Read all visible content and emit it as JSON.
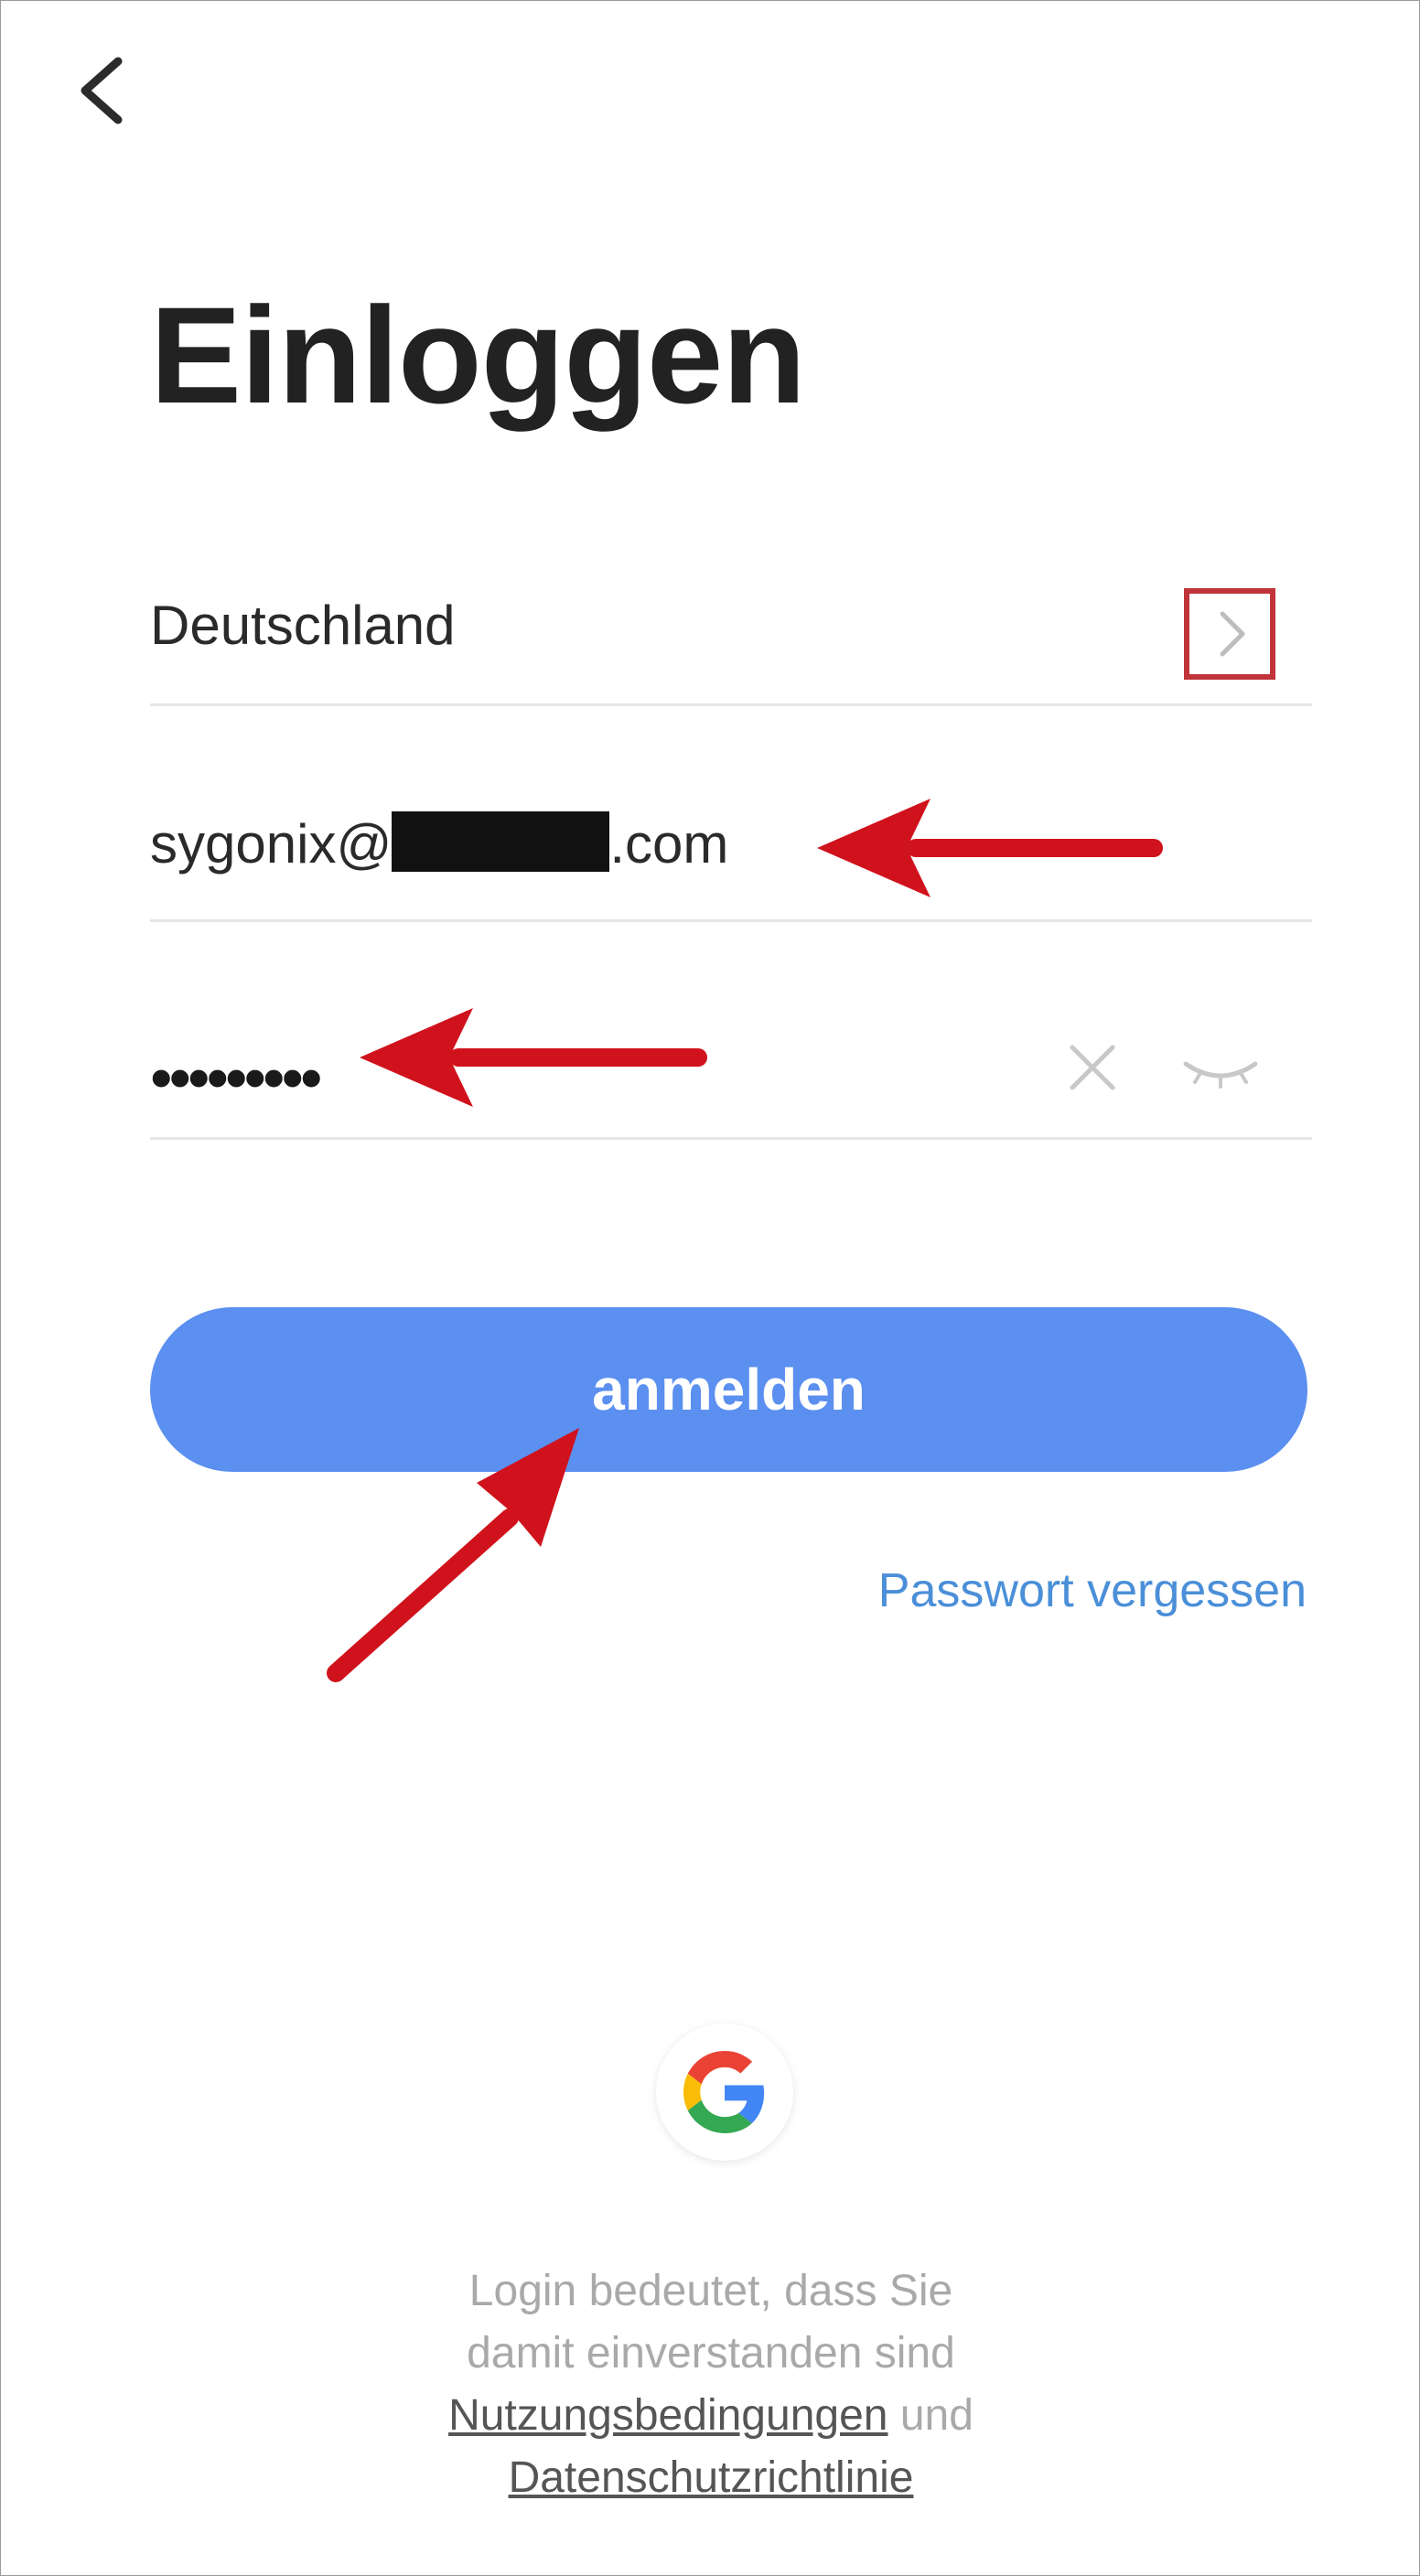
{
  "login": {
    "title": "Einloggen",
    "country": "Deutschland",
    "email_prefix": "sygonix@",
    "email_suffix": ".com",
    "password_mask": "•••••••••",
    "login_button": "anmelden",
    "forgot_password": "Passwort vergessen"
  },
  "legal": {
    "line1": "Login bedeutet, dass Sie",
    "line2": "damit einverstanden sind",
    "terms_link": "Nutzungsbedingungen",
    "conjunction": "und",
    "privacy_link": "Datenschutzrichtlinie"
  },
  "icons": {
    "back": "chevron-left-icon",
    "country": "chevron-right-icon",
    "clear": "close-icon",
    "visibility": "eye-closed-icon",
    "google": "google-icon"
  },
  "colors": {
    "primary_button": "#5b8ff0",
    "link": "#4a8fd8",
    "annotation_red": "#d0121c",
    "highlight_box": "#c0343a"
  }
}
